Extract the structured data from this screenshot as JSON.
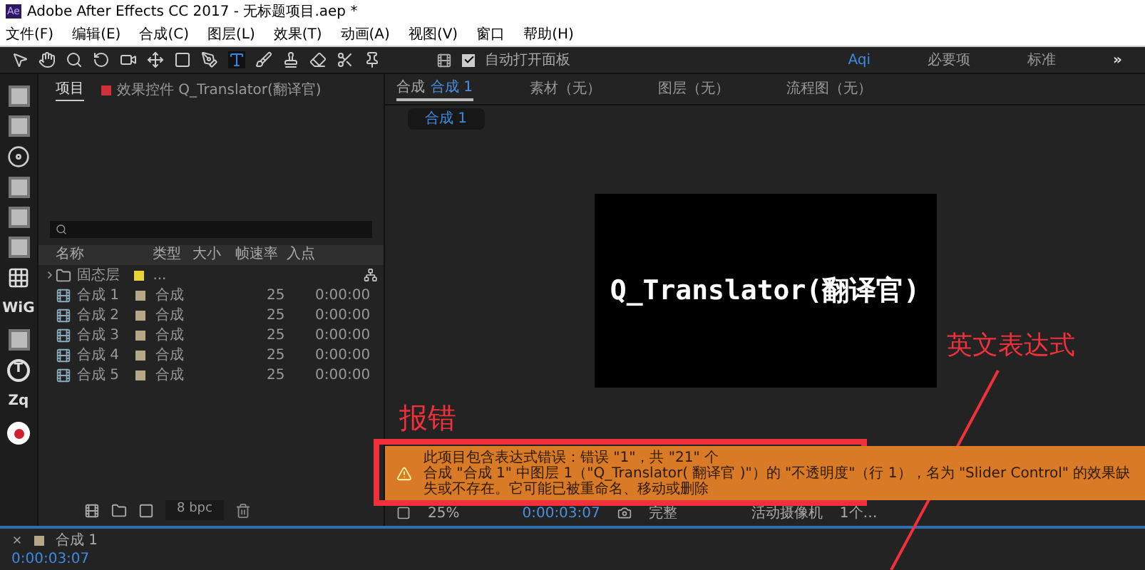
{
  "window": {
    "title": "Adobe After Effects CC 2017 - 无标题项目.aep *",
    "app_badge": "Ae"
  },
  "menu": [
    "文件(F)",
    "编辑(E)",
    "合成(C)",
    "图层(L)",
    "效果(T)",
    "动画(A)",
    "视图(V)",
    "窗口",
    "帮助(H)"
  ],
  "tools": [
    {
      "kind": "select",
      "selected": false
    },
    {
      "kind": "hand",
      "selected": false
    },
    {
      "kind": "zoom",
      "selected": false
    },
    {
      "kind": "rotate",
      "selected": false
    },
    {
      "kind": "camera",
      "selected": false
    },
    {
      "kind": "anchor",
      "selected": false
    },
    {
      "kind": "rect",
      "selected": false
    },
    {
      "kind": "pen",
      "selected": false
    },
    {
      "kind": "type",
      "selected": true
    },
    {
      "kind": "brush",
      "selected": false
    },
    {
      "kind": "stamp",
      "selected": false
    },
    {
      "kind": "eraser",
      "selected": false
    },
    {
      "kind": "roto",
      "selected": false
    },
    {
      "kind": "pin",
      "selected": false
    }
  ],
  "auto_open": {
    "label": "自动打开面板",
    "checked": true
  },
  "workspaces": [
    {
      "label": "Aqi",
      "selected": true
    },
    {
      "label": "必要项",
      "selected": false
    },
    {
      "label": "标准",
      "selected": false
    }
  ],
  "more": "»",
  "tool_strip": [
    {
      "kind": "icon"
    },
    {
      "kind": "icon"
    },
    {
      "kind": "disc"
    },
    {
      "kind": "icon"
    },
    {
      "kind": "icon"
    },
    {
      "kind": "icon"
    },
    {
      "kind": "grid"
    },
    {
      "kind": "text",
      "label": "WiG"
    },
    {
      "kind": "icon"
    },
    {
      "kind": "circle-t",
      "label": "T"
    },
    {
      "kind": "text",
      "label": "Zq"
    },
    {
      "kind": "record"
    }
  ],
  "project_panel": {
    "tabs": [
      {
        "label": "项目",
        "selected": true
      },
      {
        "label": "效果控件 Q_Translator(翻译官)",
        "selected": false
      }
    ],
    "columns": [
      "名称",
      "类型",
      "大小",
      "帧速率",
      "入点"
    ],
    "rows": [
      {
        "kind": "folder",
        "name": "固态层",
        "color": "#e8d23a",
        "type": "...",
        "size": "",
        "rate": "",
        "in": ""
      },
      {
        "kind": "comp",
        "name": "合成 1",
        "color": "#b6a886",
        "type": "合成",
        "rate": "25",
        "in": "0:00:00"
      },
      {
        "kind": "comp",
        "name": "合成 2",
        "color": "#b6a886",
        "type": "合成",
        "rate": "25",
        "in": "0:00:00"
      },
      {
        "kind": "comp",
        "name": "合成 3",
        "color": "#b6a886",
        "type": "合成",
        "rate": "25",
        "in": "0:00:00"
      },
      {
        "kind": "comp",
        "name": "合成 4",
        "color": "#b6a886",
        "type": "合成",
        "rate": "25",
        "in": "0:00:00"
      },
      {
        "kind": "comp",
        "name": "合成 5",
        "color": "#b6a886",
        "type": "合成",
        "rate": "25",
        "in": "0:00:00"
      }
    ],
    "bpc": "8 bpc"
  },
  "comp_panel": {
    "tabs": [
      {
        "label": "合成",
        "name": "合成 1",
        "selected": true
      },
      {
        "label": "素材（无）",
        "selected": false
      },
      {
        "label": "图层（无）",
        "selected": false
      },
      {
        "label": "流程图（无）",
        "selected": false
      }
    ],
    "subtab": "合成 1",
    "canvas_text": "Q_Translator(翻译官)",
    "error": {
      "line1": "此项目包含表达式错误：错误 \"1\"，共 \"21\" 个",
      "line2": "合成 \"合成 1\" 中图层 1（\"Q_Translator( 翻译官 )\"）的 \"不透明度\"（行 1），名为 \"Slider Control\" 的效果缺失或不存在。它可能已被重命名、移动或删除"
    },
    "footer": {
      "zoom": "25%",
      "time": "0:00:03:07",
      "quality": "完整",
      "camera": "活动摄像机",
      "views": "1个…"
    }
  },
  "timeline": {
    "tab": "合成 1",
    "time": "0:00:03:07"
  },
  "annotations": {
    "error_label": "报错",
    "expr_label": "英文表达式"
  }
}
